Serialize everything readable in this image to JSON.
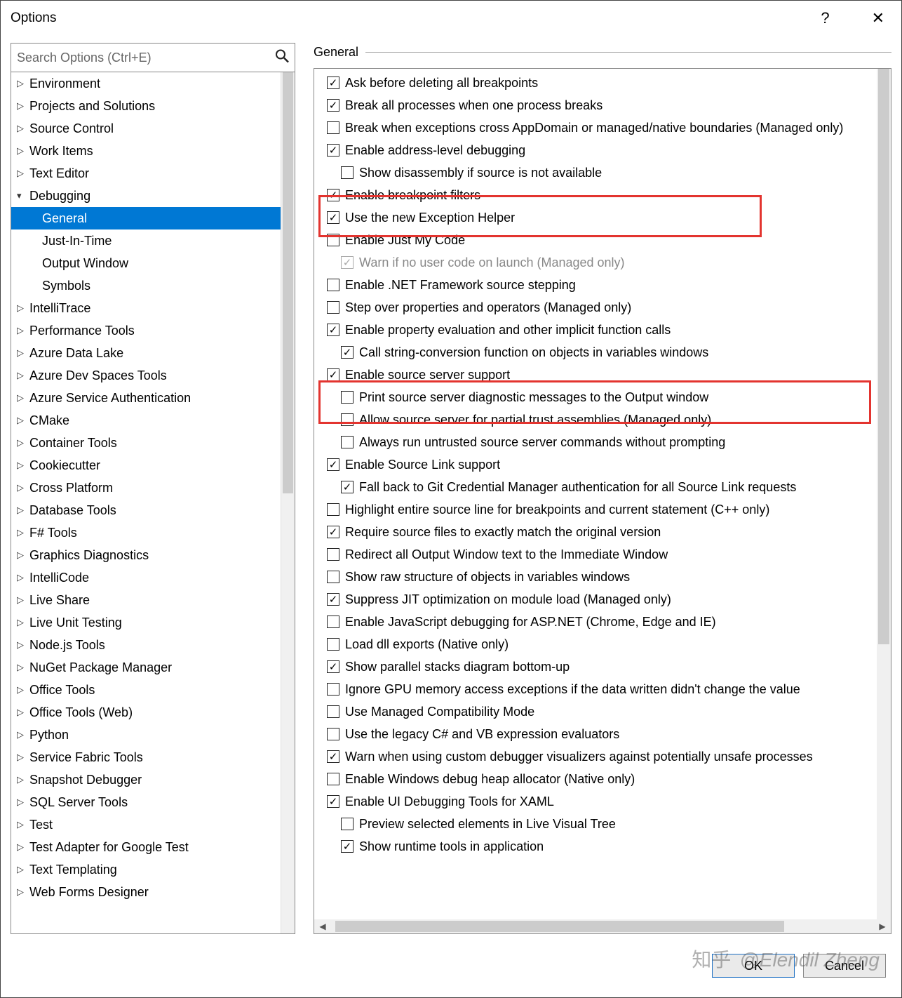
{
  "title": "Options",
  "search": {
    "placeholder": "Search Options (Ctrl+E)"
  },
  "section_title": "General",
  "tree": [
    {
      "label": "Environment",
      "expanded": false,
      "selected": false,
      "child": false
    },
    {
      "label": "Projects and Solutions",
      "expanded": false,
      "selected": false,
      "child": false
    },
    {
      "label": "Source Control",
      "expanded": false,
      "selected": false,
      "child": false
    },
    {
      "label": "Work Items",
      "expanded": false,
      "selected": false,
      "child": false
    },
    {
      "label": "Text Editor",
      "expanded": false,
      "selected": false,
      "child": false
    },
    {
      "label": "Debugging",
      "expanded": true,
      "selected": false,
      "child": false
    },
    {
      "label": "General",
      "expanded": null,
      "selected": true,
      "child": true
    },
    {
      "label": "Just-In-Time",
      "expanded": null,
      "selected": false,
      "child": true
    },
    {
      "label": "Output Window",
      "expanded": null,
      "selected": false,
      "child": true
    },
    {
      "label": "Symbols",
      "expanded": null,
      "selected": false,
      "child": true
    },
    {
      "label": "IntelliTrace",
      "expanded": false,
      "selected": false,
      "child": false
    },
    {
      "label": "Performance Tools",
      "expanded": false,
      "selected": false,
      "child": false
    },
    {
      "label": "Azure Data Lake",
      "expanded": false,
      "selected": false,
      "child": false
    },
    {
      "label": "Azure Dev Spaces Tools",
      "expanded": false,
      "selected": false,
      "child": false
    },
    {
      "label": "Azure Service Authentication",
      "expanded": false,
      "selected": false,
      "child": false
    },
    {
      "label": "CMake",
      "expanded": false,
      "selected": false,
      "child": false
    },
    {
      "label": "Container Tools",
      "expanded": false,
      "selected": false,
      "child": false
    },
    {
      "label": "Cookiecutter",
      "expanded": false,
      "selected": false,
      "child": false
    },
    {
      "label": "Cross Platform",
      "expanded": false,
      "selected": false,
      "child": false
    },
    {
      "label": "Database Tools",
      "expanded": false,
      "selected": false,
      "child": false
    },
    {
      "label": "F# Tools",
      "expanded": false,
      "selected": false,
      "child": false
    },
    {
      "label": "Graphics Diagnostics",
      "expanded": false,
      "selected": false,
      "child": false
    },
    {
      "label": "IntelliCode",
      "expanded": false,
      "selected": false,
      "child": false
    },
    {
      "label": "Live Share",
      "expanded": false,
      "selected": false,
      "child": false
    },
    {
      "label": "Live Unit Testing",
      "expanded": false,
      "selected": false,
      "child": false
    },
    {
      "label": "Node.js Tools",
      "expanded": false,
      "selected": false,
      "child": false
    },
    {
      "label": "NuGet Package Manager",
      "expanded": false,
      "selected": false,
      "child": false
    },
    {
      "label": "Office Tools",
      "expanded": false,
      "selected": false,
      "child": false
    },
    {
      "label": "Office Tools (Web)",
      "expanded": false,
      "selected": false,
      "child": false
    },
    {
      "label": "Python",
      "expanded": false,
      "selected": false,
      "child": false
    },
    {
      "label": "Service Fabric Tools",
      "expanded": false,
      "selected": false,
      "child": false
    },
    {
      "label": "Snapshot Debugger",
      "expanded": false,
      "selected": false,
      "child": false
    },
    {
      "label": "SQL Server Tools",
      "expanded": false,
      "selected": false,
      "child": false
    },
    {
      "label": "Test",
      "expanded": false,
      "selected": false,
      "child": false
    },
    {
      "label": "Test Adapter for Google Test",
      "expanded": false,
      "selected": false,
      "child": false
    },
    {
      "label": "Text Templating",
      "expanded": false,
      "selected": false,
      "child": false
    },
    {
      "label": "Web Forms Designer",
      "expanded": false,
      "selected": false,
      "child": false
    }
  ],
  "options": [
    {
      "label": "Ask before deleting all breakpoints",
      "checked": true,
      "indent": 1,
      "disabled": false
    },
    {
      "label": "Break all processes when one process breaks",
      "checked": true,
      "indent": 1,
      "disabled": false
    },
    {
      "label": "Break when exceptions cross AppDomain or managed/native boundaries (Managed only)",
      "checked": false,
      "indent": 1,
      "disabled": false
    },
    {
      "label": "Enable address-level debugging",
      "checked": true,
      "indent": 1,
      "disabled": false
    },
    {
      "label": "Show disassembly if source is not available",
      "checked": false,
      "indent": 2,
      "disabled": false
    },
    {
      "label": "Enable breakpoint filters",
      "checked": true,
      "indent": 1,
      "disabled": false
    },
    {
      "label": "Use the new Exception Helper",
      "checked": true,
      "indent": 1,
      "disabled": false
    },
    {
      "label": "Enable Just My Code",
      "checked": false,
      "indent": 1,
      "disabled": false
    },
    {
      "label": "Warn if no user code on launch (Managed only)",
      "checked": true,
      "indent": 2,
      "disabled": true
    },
    {
      "label": "Enable .NET Framework source stepping",
      "checked": false,
      "indent": 1,
      "disabled": false
    },
    {
      "label": "Step over properties and operators (Managed only)",
      "checked": false,
      "indent": 1,
      "disabled": false
    },
    {
      "label": "Enable property evaluation and other implicit function calls",
      "checked": true,
      "indent": 1,
      "disabled": false
    },
    {
      "label": "Call string-conversion function on objects in variables windows",
      "checked": true,
      "indent": 2,
      "disabled": false
    },
    {
      "label": "Enable source server support",
      "checked": true,
      "indent": 1,
      "disabled": false
    },
    {
      "label": "Print source server diagnostic messages to the Output window",
      "checked": false,
      "indent": 2,
      "disabled": false
    },
    {
      "label": "Allow source server for partial trust assemblies (Managed only)",
      "checked": false,
      "indent": 2,
      "disabled": false
    },
    {
      "label": "Always run untrusted source server commands without prompting",
      "checked": false,
      "indent": 2,
      "disabled": false
    },
    {
      "label": "Enable Source Link support",
      "checked": true,
      "indent": 1,
      "disabled": false
    },
    {
      "label": "Fall back to Git Credential Manager authentication for all Source Link requests",
      "checked": true,
      "indent": 2,
      "disabled": false
    },
    {
      "label": "Highlight entire source line for breakpoints and current statement (C++ only)",
      "checked": false,
      "indent": 1,
      "disabled": false
    },
    {
      "label": "Require source files to exactly match the original version",
      "checked": true,
      "indent": 1,
      "disabled": false
    },
    {
      "label": "Redirect all Output Window text to the Immediate Window",
      "checked": false,
      "indent": 1,
      "disabled": false
    },
    {
      "label": "Show raw structure of objects in variables windows",
      "checked": false,
      "indent": 1,
      "disabled": false
    },
    {
      "label": "Suppress JIT optimization on module load (Managed only)",
      "checked": true,
      "indent": 1,
      "disabled": false
    },
    {
      "label": "Enable JavaScript debugging for ASP.NET (Chrome, Edge and IE)",
      "checked": false,
      "indent": 1,
      "disabled": false
    },
    {
      "label": "Load dll exports (Native only)",
      "checked": false,
      "indent": 1,
      "disabled": false
    },
    {
      "label": "Show parallel stacks diagram bottom-up",
      "checked": true,
      "indent": 1,
      "disabled": false
    },
    {
      "label": "Ignore GPU memory access exceptions if the data written didn't change the value",
      "checked": false,
      "indent": 1,
      "disabled": false
    },
    {
      "label": "Use Managed Compatibility Mode",
      "checked": false,
      "indent": 1,
      "disabled": false
    },
    {
      "label": "Use the legacy C# and VB expression evaluators",
      "checked": false,
      "indent": 1,
      "disabled": false
    },
    {
      "label": "Warn when using custom debugger visualizers against potentially unsafe processes",
      "checked": true,
      "indent": 1,
      "disabled": false
    },
    {
      "label": "Enable Windows debug heap allocator (Native only)",
      "checked": false,
      "indent": 1,
      "disabled": false
    },
    {
      "label": "Enable UI Debugging Tools for XAML",
      "checked": true,
      "indent": 1,
      "disabled": false
    },
    {
      "label": "Preview selected elements in Live Visual Tree",
      "checked": false,
      "indent": 2,
      "disabled": false
    },
    {
      "label": "Show runtime tools in application",
      "checked": true,
      "indent": 2,
      "disabled": false
    }
  ],
  "buttons": {
    "ok": "OK",
    "cancel": "Cancel"
  },
  "watermark": {
    "zh": "知乎",
    "author": "@Elendil Zheng"
  },
  "colors": {
    "selection": "#0078d4",
    "highlight": "#e3342f"
  }
}
